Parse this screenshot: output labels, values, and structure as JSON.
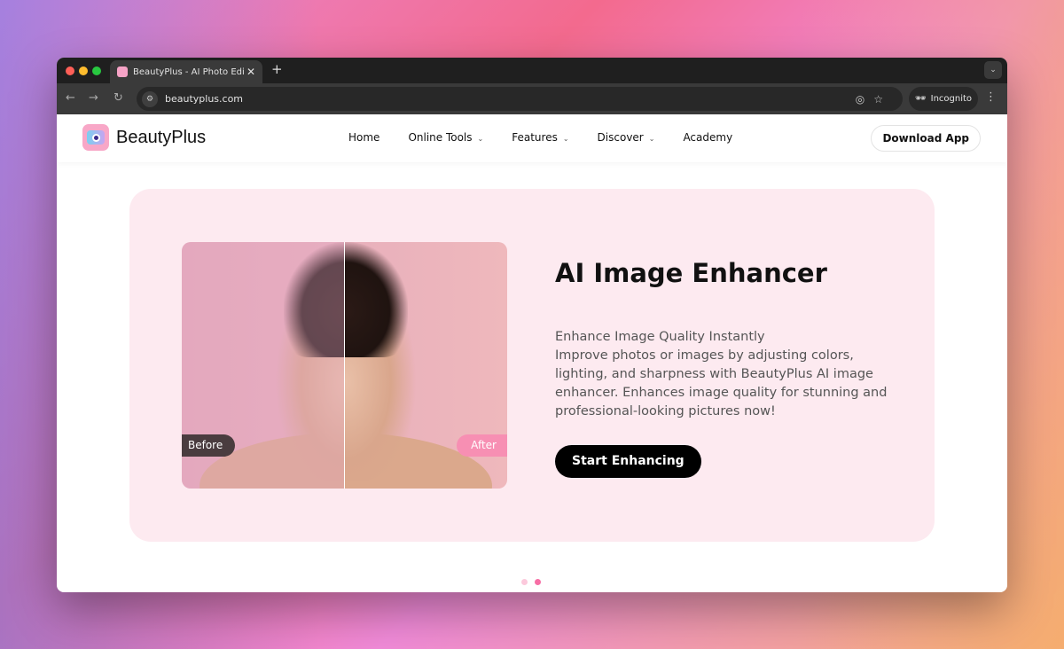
{
  "browser": {
    "tab_title": "BeautyPlus - AI Photo Editor & ...",
    "url": "beautyplus.com",
    "incognito_label": "Incognito"
  },
  "site": {
    "logo_text": "BeautyPlus",
    "nav": [
      {
        "label": "Home",
        "dropdown": false
      },
      {
        "label": "Online Tools",
        "dropdown": true
      },
      {
        "label": "Features",
        "dropdown": true
      },
      {
        "label": "Discover",
        "dropdown": true
      },
      {
        "label": "Academy",
        "dropdown": false
      }
    ],
    "download_label": "Download App"
  },
  "hero": {
    "title": "AI Image Enhancer",
    "subtitle": "Enhance Image Quality Instantly",
    "description": "Improve photos or images by adjusting colors, lighting, and sharpness with BeautyPlus AI image enhancer. Enhances image quality for stunning and professional-looking pictures now!",
    "before_label": "Before",
    "after_label": "After",
    "cta_label": "Start Enhancing"
  },
  "carousel": {
    "total": 2,
    "active": 2
  },
  "colors": {
    "hero_bg": "#fdeaf0",
    "accent": "#f76ea5",
    "cta": "#000000"
  }
}
